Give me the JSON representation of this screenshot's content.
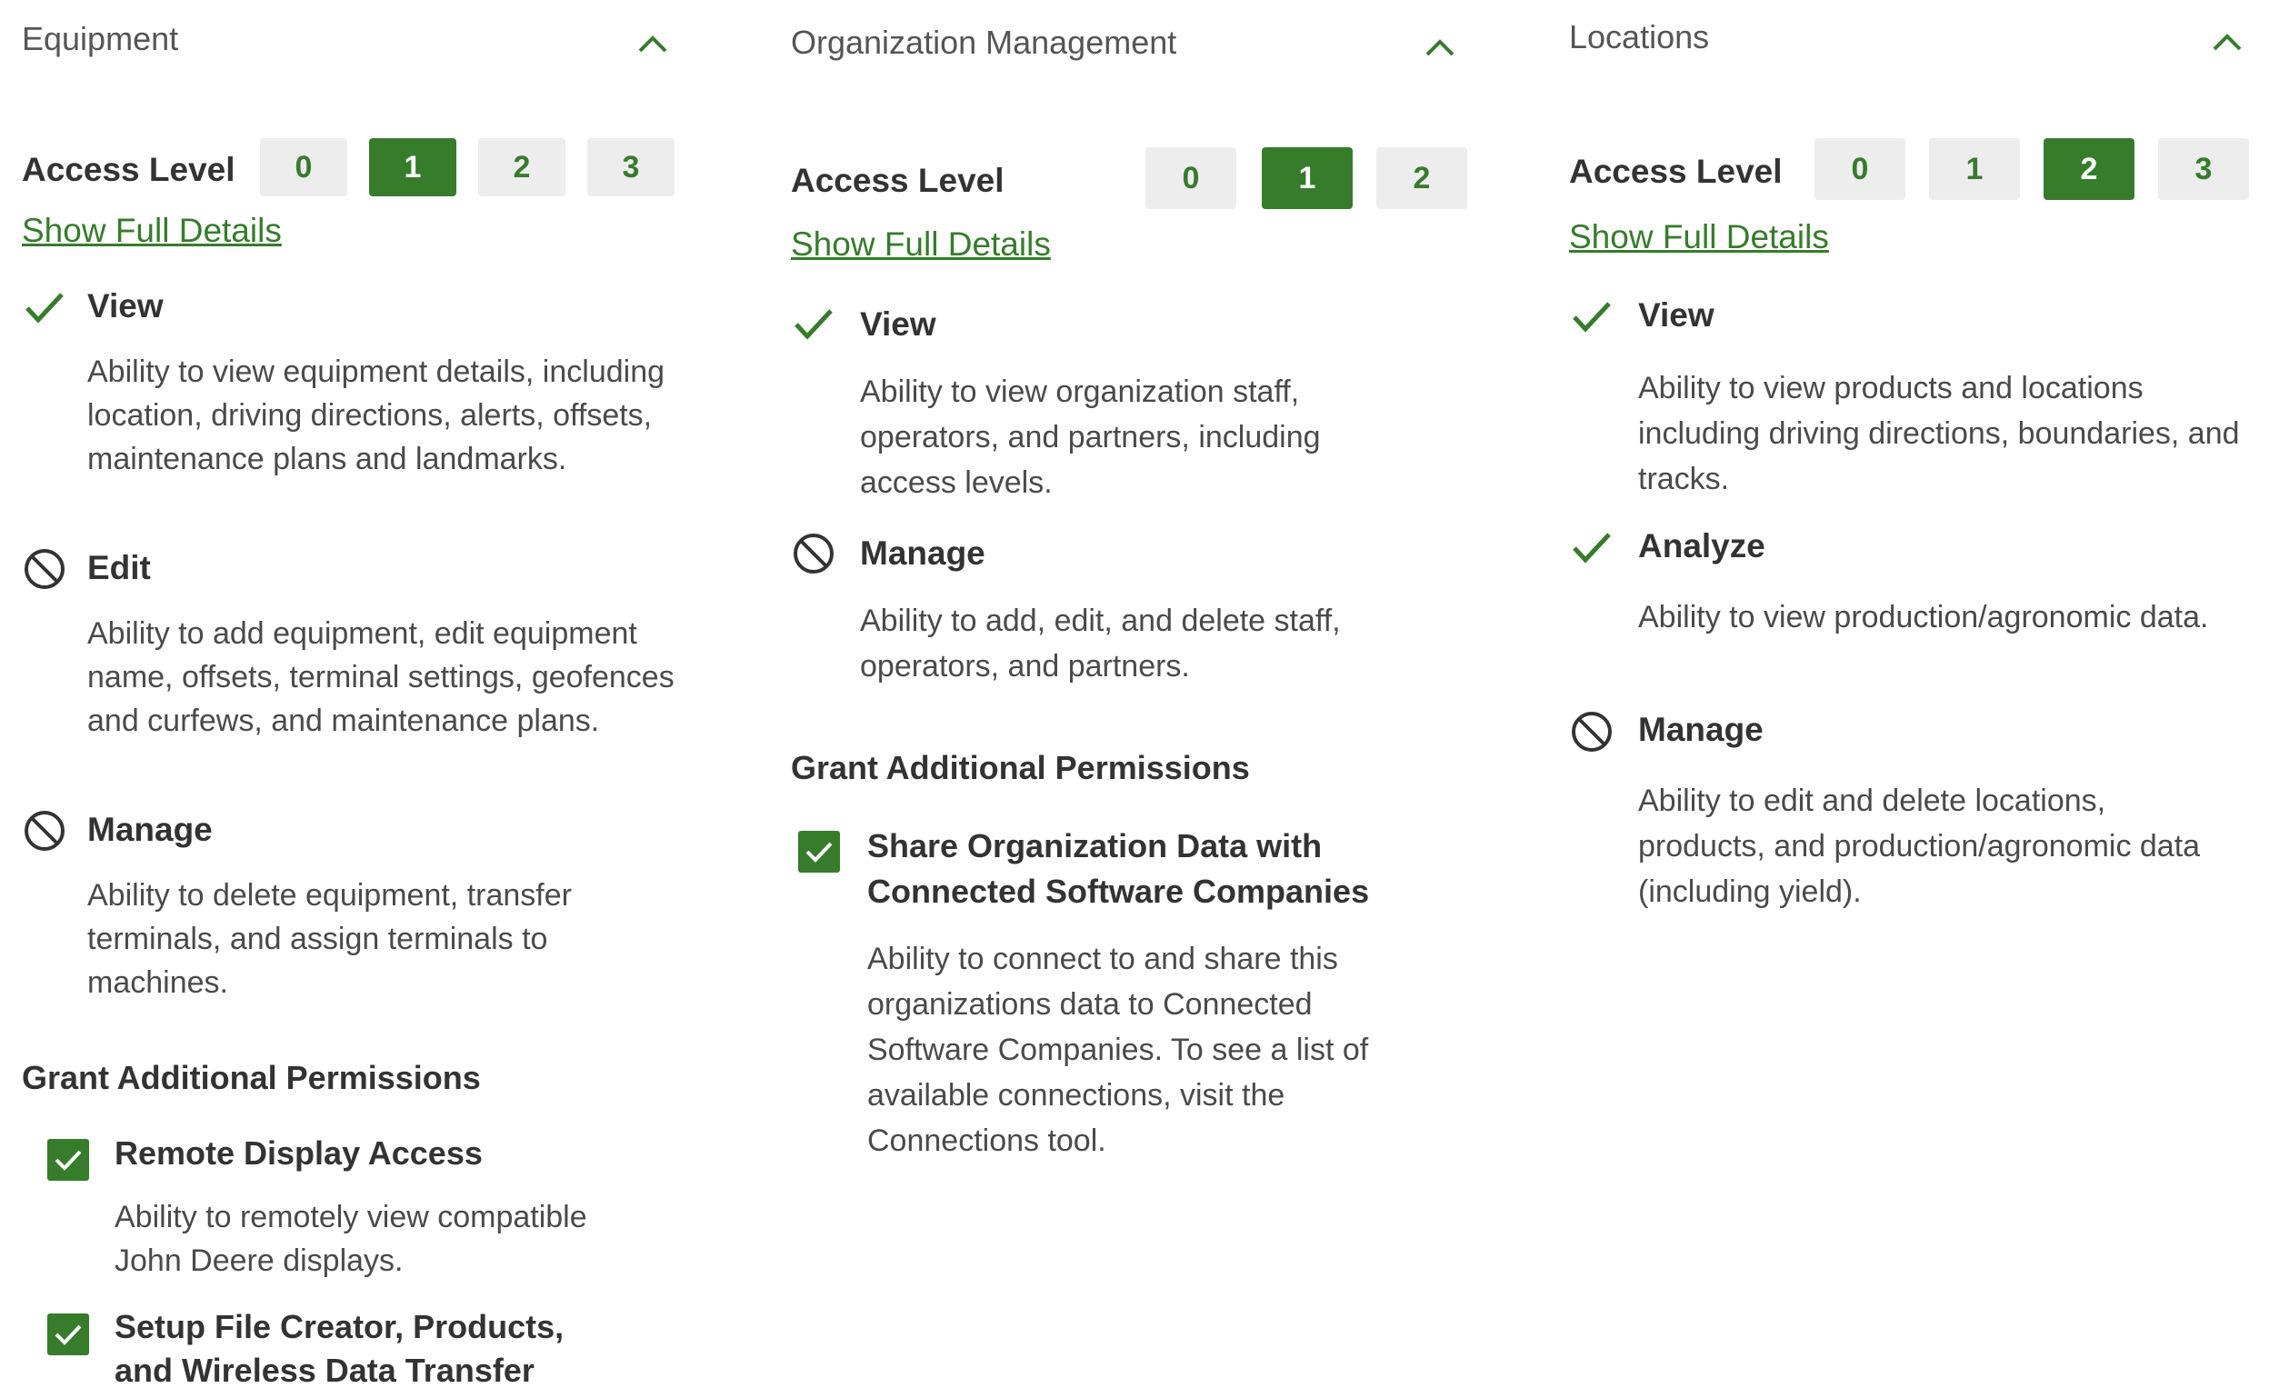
{
  "colors": {
    "accent": "#367c2b",
    "inactive_button": "#ededed",
    "text": "#333333",
    "muted_text": "#4a4a4a"
  },
  "panels": [
    {
      "title": "Equipment",
      "access_label": "Access Level",
      "levels": [
        "0",
        "1",
        "2",
        "3"
      ],
      "selected_level": "1",
      "details_link": "Show Full Details",
      "permissions": [
        {
          "icon": "check-icon",
          "status": "granted",
          "title": "View",
          "desc": "Ability to view equipment details, including location, driving directions, alerts, offsets, maintenance plans and landmarks."
        },
        {
          "icon": "prohibited-icon",
          "status": "not-granted",
          "title": "Edit",
          "desc": "Ability to add equipment, edit equipment name, offsets, terminal settings, geofences and curfews, and maintenance plans."
        },
        {
          "icon": "prohibited-icon",
          "status": "not-granted",
          "title": "Manage",
          "desc": "Ability to delete equipment, transfer terminals, and assign terminals to machines."
        }
      ],
      "additional_title": "Grant Additional Permissions",
      "additional": [
        {
          "checked": true,
          "title": "Remote Display Access",
          "desc": "Ability to remotely view compatible John Deere displays."
        },
        {
          "checked": true,
          "title": "Setup File Creator, Products, and Wireless Data Transfer"
        }
      ]
    },
    {
      "title": "Organization Management",
      "access_label": "Access Level",
      "levels": [
        "0",
        "1",
        "2"
      ],
      "selected_level": "1",
      "details_link": "Show Full Details",
      "permissions": [
        {
          "icon": "check-icon",
          "status": "granted",
          "title": "View",
          "desc": "Ability to view organization staff, operators, and partners, including access levels."
        },
        {
          "icon": "prohibited-icon",
          "status": "not-granted",
          "title": "Manage",
          "desc": "Ability to add, edit, and delete staff, operators, and partners."
        }
      ],
      "additional_title": "Grant Additional Permissions",
      "additional": [
        {
          "checked": true,
          "title": "Share Organization Data with Connected Software Companies",
          "desc": "Ability to connect to and share this organizations data to Connected Software Companies. To see a list of available connections, visit the Connections tool."
        }
      ]
    },
    {
      "title": "Locations",
      "access_label": "Access Level",
      "levels": [
        "0",
        "1",
        "2",
        "3"
      ],
      "selected_level": "2",
      "details_link": "Show Full Details",
      "permissions": [
        {
          "icon": "check-icon",
          "status": "granted",
          "title": "View",
          "desc": "Ability to view products and locations including driving directions, boundaries, and tracks."
        },
        {
          "icon": "check-icon",
          "status": "granted",
          "title": "Analyze",
          "desc": "Ability to view production/agronomic data."
        },
        {
          "icon": "prohibited-icon",
          "status": "not-granted",
          "title": "Manage",
          "desc": "Ability to edit and delete locations, products, and production/agronomic data (including yield)."
        }
      ]
    }
  ]
}
